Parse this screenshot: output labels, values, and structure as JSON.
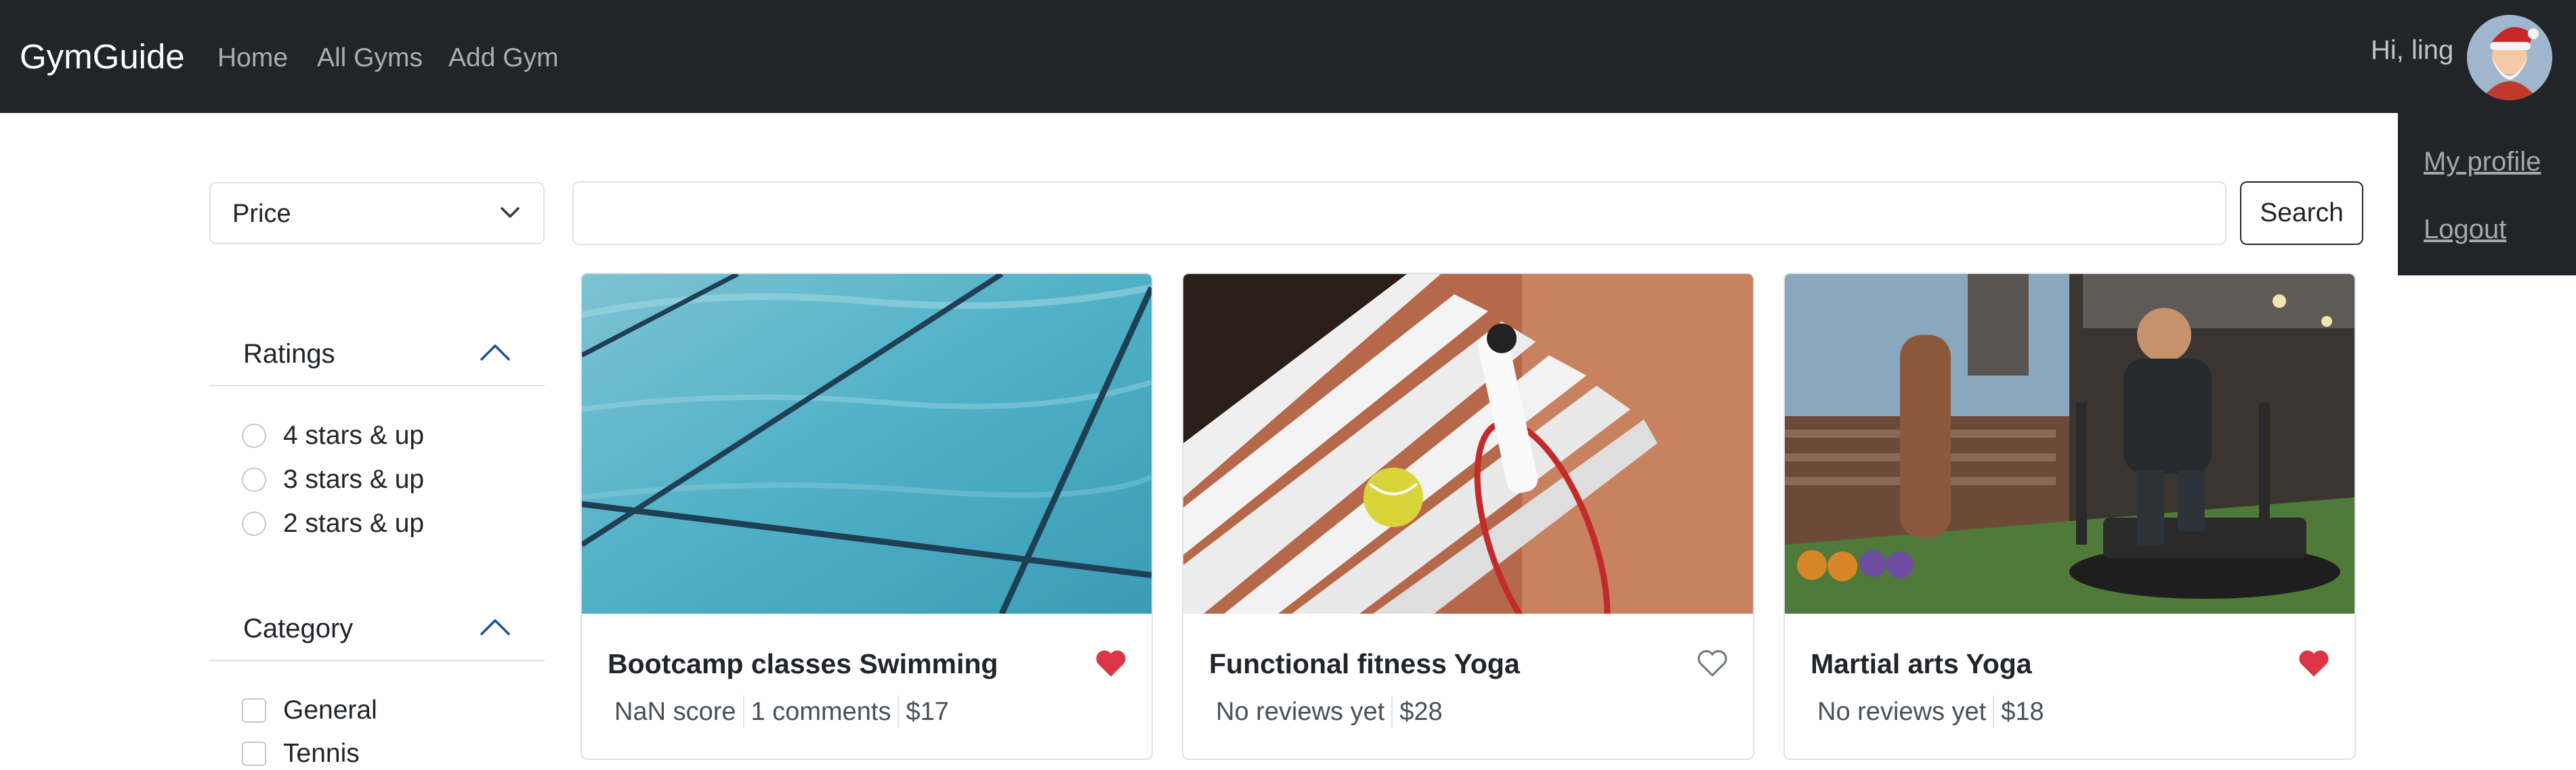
{
  "navbar": {
    "brand": "GymGuide",
    "links": [
      "Home",
      "All Gyms",
      "Add Gym"
    ],
    "greeting": "Hi, ling",
    "avatar_icon": "santa-avatar-icon",
    "dropdown": {
      "my_profile": "My profile",
      "logout": "Logout"
    }
  },
  "search": {
    "price_select": "Price",
    "query": "",
    "button": "Search"
  },
  "filters": {
    "ratings": {
      "title": "Ratings",
      "options": [
        "4 stars & up",
        "3 stars & up",
        "2 stars & up"
      ]
    },
    "category": {
      "title": "Category",
      "options": [
        "General",
        "Tennis"
      ]
    }
  },
  "cards": [
    {
      "title": "Bootcamp classes Swimming",
      "score": "NaN score",
      "comments": "1 comments",
      "price": "$17",
      "favorited": true,
      "image": "swimming-pool-image"
    },
    {
      "title": "Functional fitness Yoga",
      "score": "No reviews yet",
      "price": "$28",
      "favorited": false,
      "image": "tennis-racket-image"
    },
    {
      "title": "Martial arts Yoga",
      "score": "No reviews yet",
      "price": "$18",
      "favorited": true,
      "image": "gym-sled-image"
    }
  ],
  "colors": {
    "navbar": "#212529",
    "heart_filled": "#dc3545",
    "heart_outline": "#6c757d"
  }
}
